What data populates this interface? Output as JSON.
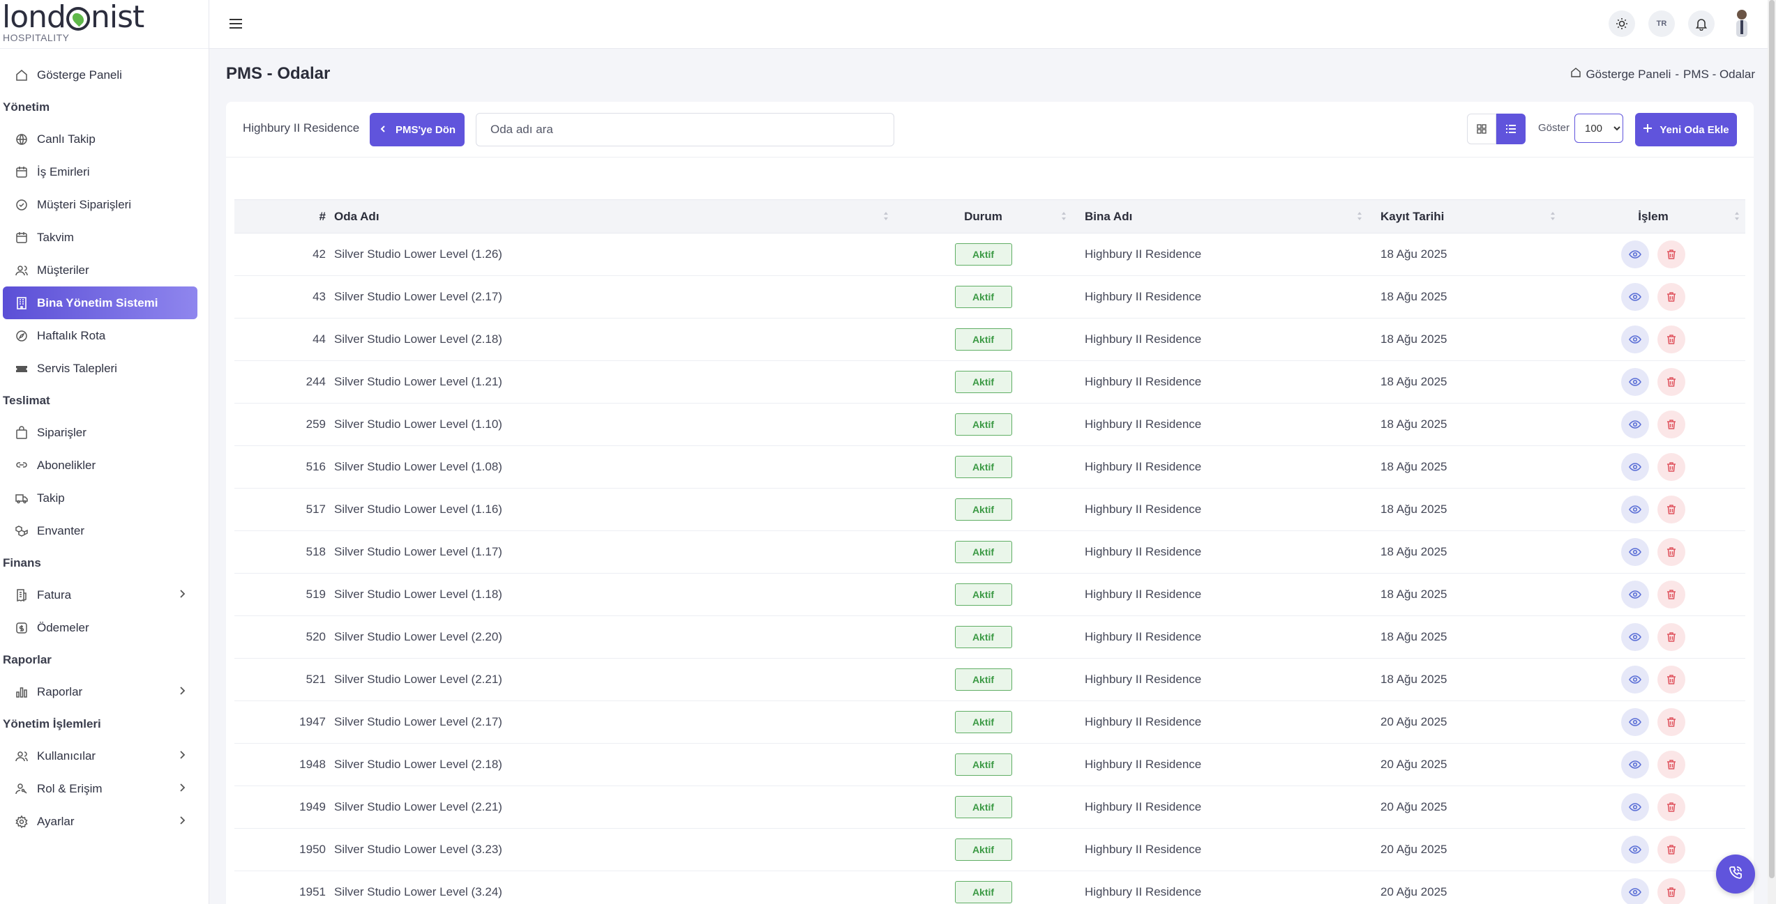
{
  "brand": {
    "logo_left": "lond",
    "logo_right": "nist",
    "logo_sub": "HOSPITALITY"
  },
  "sidebar": {
    "dashboard": "Gösterge Paneli",
    "groups": {
      "management": "Yönetim",
      "delivery": "Teslimat",
      "finance": "Finans",
      "reports": "Raporlar",
      "admin": "Yönetim İşlemleri"
    },
    "items": {
      "live_tracking": "Canlı Takip",
      "work_orders": "İş Emirleri",
      "customer_orders": "Müşteri Siparişleri",
      "calendar": "Takvim",
      "customers": "Müşteriler",
      "building_mgmt": "Bina Yönetim Sistemi",
      "weekly_route": "Haftalık Rota",
      "service_requests": "Servis Talepleri",
      "orders": "Siparişler",
      "subscriptions": "Abonelikler",
      "tracking": "Takip",
      "inventory": "Envanter",
      "invoice": "Fatura",
      "payments": "Ödemeler",
      "reports": "Raporlar",
      "users": "Kullanıcılar",
      "roles": "Rol & Erişim",
      "settings": "Ayarlar"
    }
  },
  "topbar": {
    "lang": "TR"
  },
  "page": {
    "title": "PMS - Odalar",
    "breadcrumb_home": "Gösterge Paneli",
    "breadcrumb_sep": "-",
    "breadcrumb_current": "PMS - Odalar"
  },
  "toolbar": {
    "property_name": "Highbury II Residence",
    "back_label": "PMS'ye Dön",
    "search_placeholder": "Oda adı ara",
    "show_label": "Göster",
    "page_size": "100",
    "add_label": "Yeni Oda Ekle"
  },
  "table": {
    "headers": {
      "num": "#",
      "room": "Oda Adı",
      "status": "Durum",
      "building": "Bina Adı",
      "date": "Kayıt Tarihi",
      "action": "İşlem"
    },
    "rows": [
      {
        "id": "42",
        "room": "Silver Studio Lower Level (1.26)",
        "status": "Aktif",
        "building": "Highbury II Residence",
        "date": "18 Ağu 2025"
      },
      {
        "id": "43",
        "room": "Silver Studio Lower Level (2.17)",
        "status": "Aktif",
        "building": "Highbury II Residence",
        "date": "18 Ağu 2025"
      },
      {
        "id": "44",
        "room": "Silver Studio Lower Level (2.18)",
        "status": "Aktif",
        "building": "Highbury II Residence",
        "date": "18 Ağu 2025"
      },
      {
        "id": "244",
        "room": "Silver Studio Lower Level (1.21)",
        "status": "Aktif",
        "building": "Highbury II Residence",
        "date": "18 Ağu 2025"
      },
      {
        "id": "259",
        "room": "Silver Studio Lower Level (1.10)",
        "status": "Aktif",
        "building": "Highbury II Residence",
        "date": "18 Ağu 2025"
      },
      {
        "id": "516",
        "room": "Silver Studio Lower Level (1.08)",
        "status": "Aktif",
        "building": "Highbury II Residence",
        "date": "18 Ağu 2025"
      },
      {
        "id": "517",
        "room": "Silver Studio Lower Level (1.16)",
        "status": "Aktif",
        "building": "Highbury II Residence",
        "date": "18 Ağu 2025"
      },
      {
        "id": "518",
        "room": "Silver Studio Lower Level (1.17)",
        "status": "Aktif",
        "building": "Highbury II Residence",
        "date": "18 Ağu 2025"
      },
      {
        "id": "519",
        "room": "Silver Studio Lower Level (1.18)",
        "status": "Aktif",
        "building": "Highbury II Residence",
        "date": "18 Ağu 2025"
      },
      {
        "id": "520",
        "room": "Silver Studio Lower Level (2.20)",
        "status": "Aktif",
        "building": "Highbury II Residence",
        "date": "18 Ağu 2025"
      },
      {
        "id": "521",
        "room": "Silver Studio Lower Level (2.21)",
        "status": "Aktif",
        "building": "Highbury II Residence",
        "date": "18 Ağu 2025"
      },
      {
        "id": "1947",
        "room": "Silver Studio Lower Level (2.17)",
        "status": "Aktif",
        "building": "Highbury II Residence",
        "date": "20 Ağu 2025"
      },
      {
        "id": "1948",
        "room": "Silver Studio Lower Level (2.18)",
        "status": "Aktif",
        "building": "Highbury II Residence",
        "date": "20 Ağu 2025"
      },
      {
        "id": "1949",
        "room": "Silver Studio Lower Level (2.21)",
        "status": "Aktif",
        "building": "Highbury II Residence",
        "date": "20 Ağu 2025"
      },
      {
        "id": "1950",
        "room": "Silver Studio Lower Level (3.23)",
        "status": "Aktif",
        "building": "Highbury II Residence",
        "date": "20 Ağu 2025"
      },
      {
        "id": "1951",
        "room": "Silver Studio Lower Level (3.24)",
        "status": "Aktif",
        "building": "Highbury II Residence",
        "date": "20 Ağu 2025"
      }
    ]
  },
  "colors": {
    "accent": "#6054dc",
    "success": "#3c9a45",
    "danger": "#e0545f"
  }
}
